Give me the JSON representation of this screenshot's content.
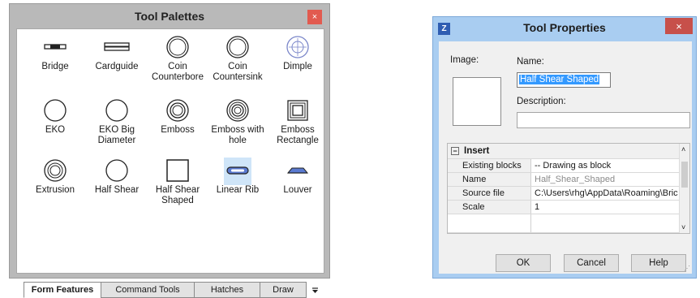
{
  "palette": {
    "title": "Tool Palettes",
    "close_label": "×",
    "tools": [
      {
        "label": "Bridge"
      },
      {
        "label": "Cardguide"
      },
      {
        "label": "Coin Counterbore"
      },
      {
        "label": "Coin Countersink"
      },
      {
        "label": "Dimple"
      },
      {
        "label": "EKO"
      },
      {
        "label": "EKO Big Diameter"
      },
      {
        "label": "Emboss"
      },
      {
        "label": "Emboss with hole"
      },
      {
        "label": "Emboss Rectangle"
      },
      {
        "label": "Extrusion"
      },
      {
        "label": "Half Shear"
      },
      {
        "label": "Half Shear Shaped"
      },
      {
        "label": "Linear Rib"
      },
      {
        "label": "Louver"
      }
    ],
    "selected_tool": "Linear Rib",
    "tabs": [
      {
        "label": "Form Features",
        "active": true
      },
      {
        "label": "Command Tools"
      },
      {
        "label": "Hatches"
      },
      {
        "label": "Draw"
      }
    ],
    "tab_overflow_icon": "tab-overflow-icon"
  },
  "properties": {
    "title": "Tool Properties",
    "app_icon_glyph": "Z",
    "close_label": "×",
    "image_label": "Image:",
    "name_label": "Name:",
    "name_value": "Half Shear Shaped",
    "description_label": "Description:",
    "description_value": "",
    "group_toggle": "−",
    "group_title": "Insert",
    "rows": [
      {
        "key": "Existing blocks",
        "value": "-- Drawing as block"
      },
      {
        "key": "Name",
        "value": "Half_Shear_Shaped"
      },
      {
        "key": "Source file",
        "value": "C:\\Users\\rhg\\AppData\\Roaming\\Bric"
      },
      {
        "key": "Scale",
        "value": "1"
      }
    ],
    "buttons": {
      "ok": "OK",
      "cancel": "Cancel",
      "help": "Help"
    }
  },
  "colors": {
    "selection": "#3399ff",
    "selected_tool_bg": "#cfe5f8",
    "palette_close": "#e25a4f",
    "dialog_frame": "#a9cdf1"
  }
}
